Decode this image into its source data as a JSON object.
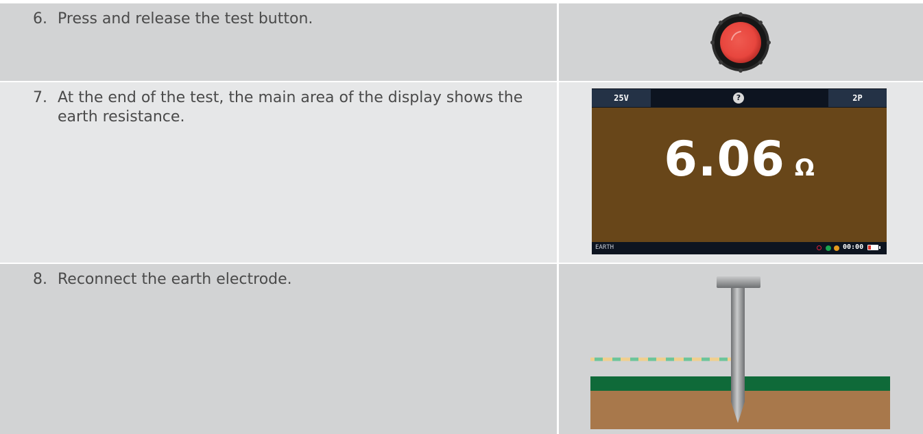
{
  "steps": [
    {
      "number": "6.",
      "text": "Press and release the test button."
    },
    {
      "number": "7.",
      "text": "At the end of the test, the main area of the display shows the earth resistance."
    },
    {
      "number": "8.",
      "text": "Reconnect the earth electrode."
    }
  ],
  "display": {
    "voltage_tab": "25V",
    "help_icon": "question-circle-icon",
    "mode_tab": "2P",
    "reading_value": "6.06",
    "reading_unit": "Ω",
    "mode_label": "EARTH",
    "timer": "00:00",
    "background_color": "#684619"
  },
  "colors": {
    "row_dark": "#d2d3d4",
    "row_light": "#e6e7e8",
    "test_button": "#e8463e",
    "grass": "#0f6a39",
    "soil": "#a8784b"
  }
}
